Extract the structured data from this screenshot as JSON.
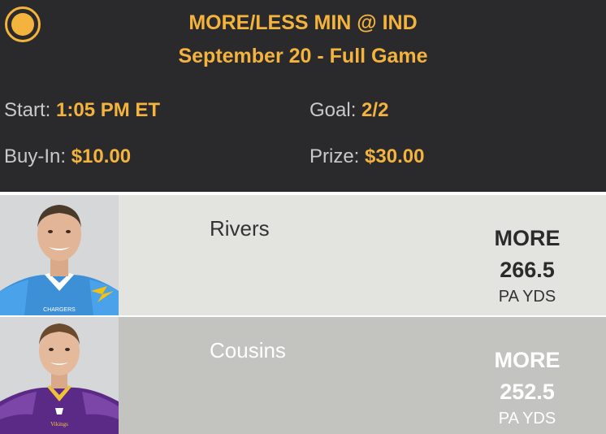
{
  "header": {
    "title": "MORE/LESS MIN @ IND",
    "subtitle": "September 20 - Full Game",
    "start_label": "Start:",
    "start_value": "1:05 PM ET",
    "goal_label": "Goal:",
    "goal_value": "2/2",
    "buyin_label": "Buy-In:",
    "buyin_value": "$10.00",
    "prize_label": "Prize:",
    "prize_value": "$30.00"
  },
  "players": [
    {
      "name": "Rivers",
      "pick": "MORE",
      "line": "266.5",
      "stat": "PA YDS",
      "jersey_text": "CHARGERS"
    },
    {
      "name": "Cousins",
      "pick": "MORE",
      "line": "252.5",
      "stat": "PA YDS",
      "jersey_text": "Vikings"
    }
  ],
  "colors": {
    "accent": "#f3b33d",
    "header_bg": "#2a2a2d",
    "row1_bg": "#e3e4df",
    "row2_bg": "#c3c4bf"
  }
}
